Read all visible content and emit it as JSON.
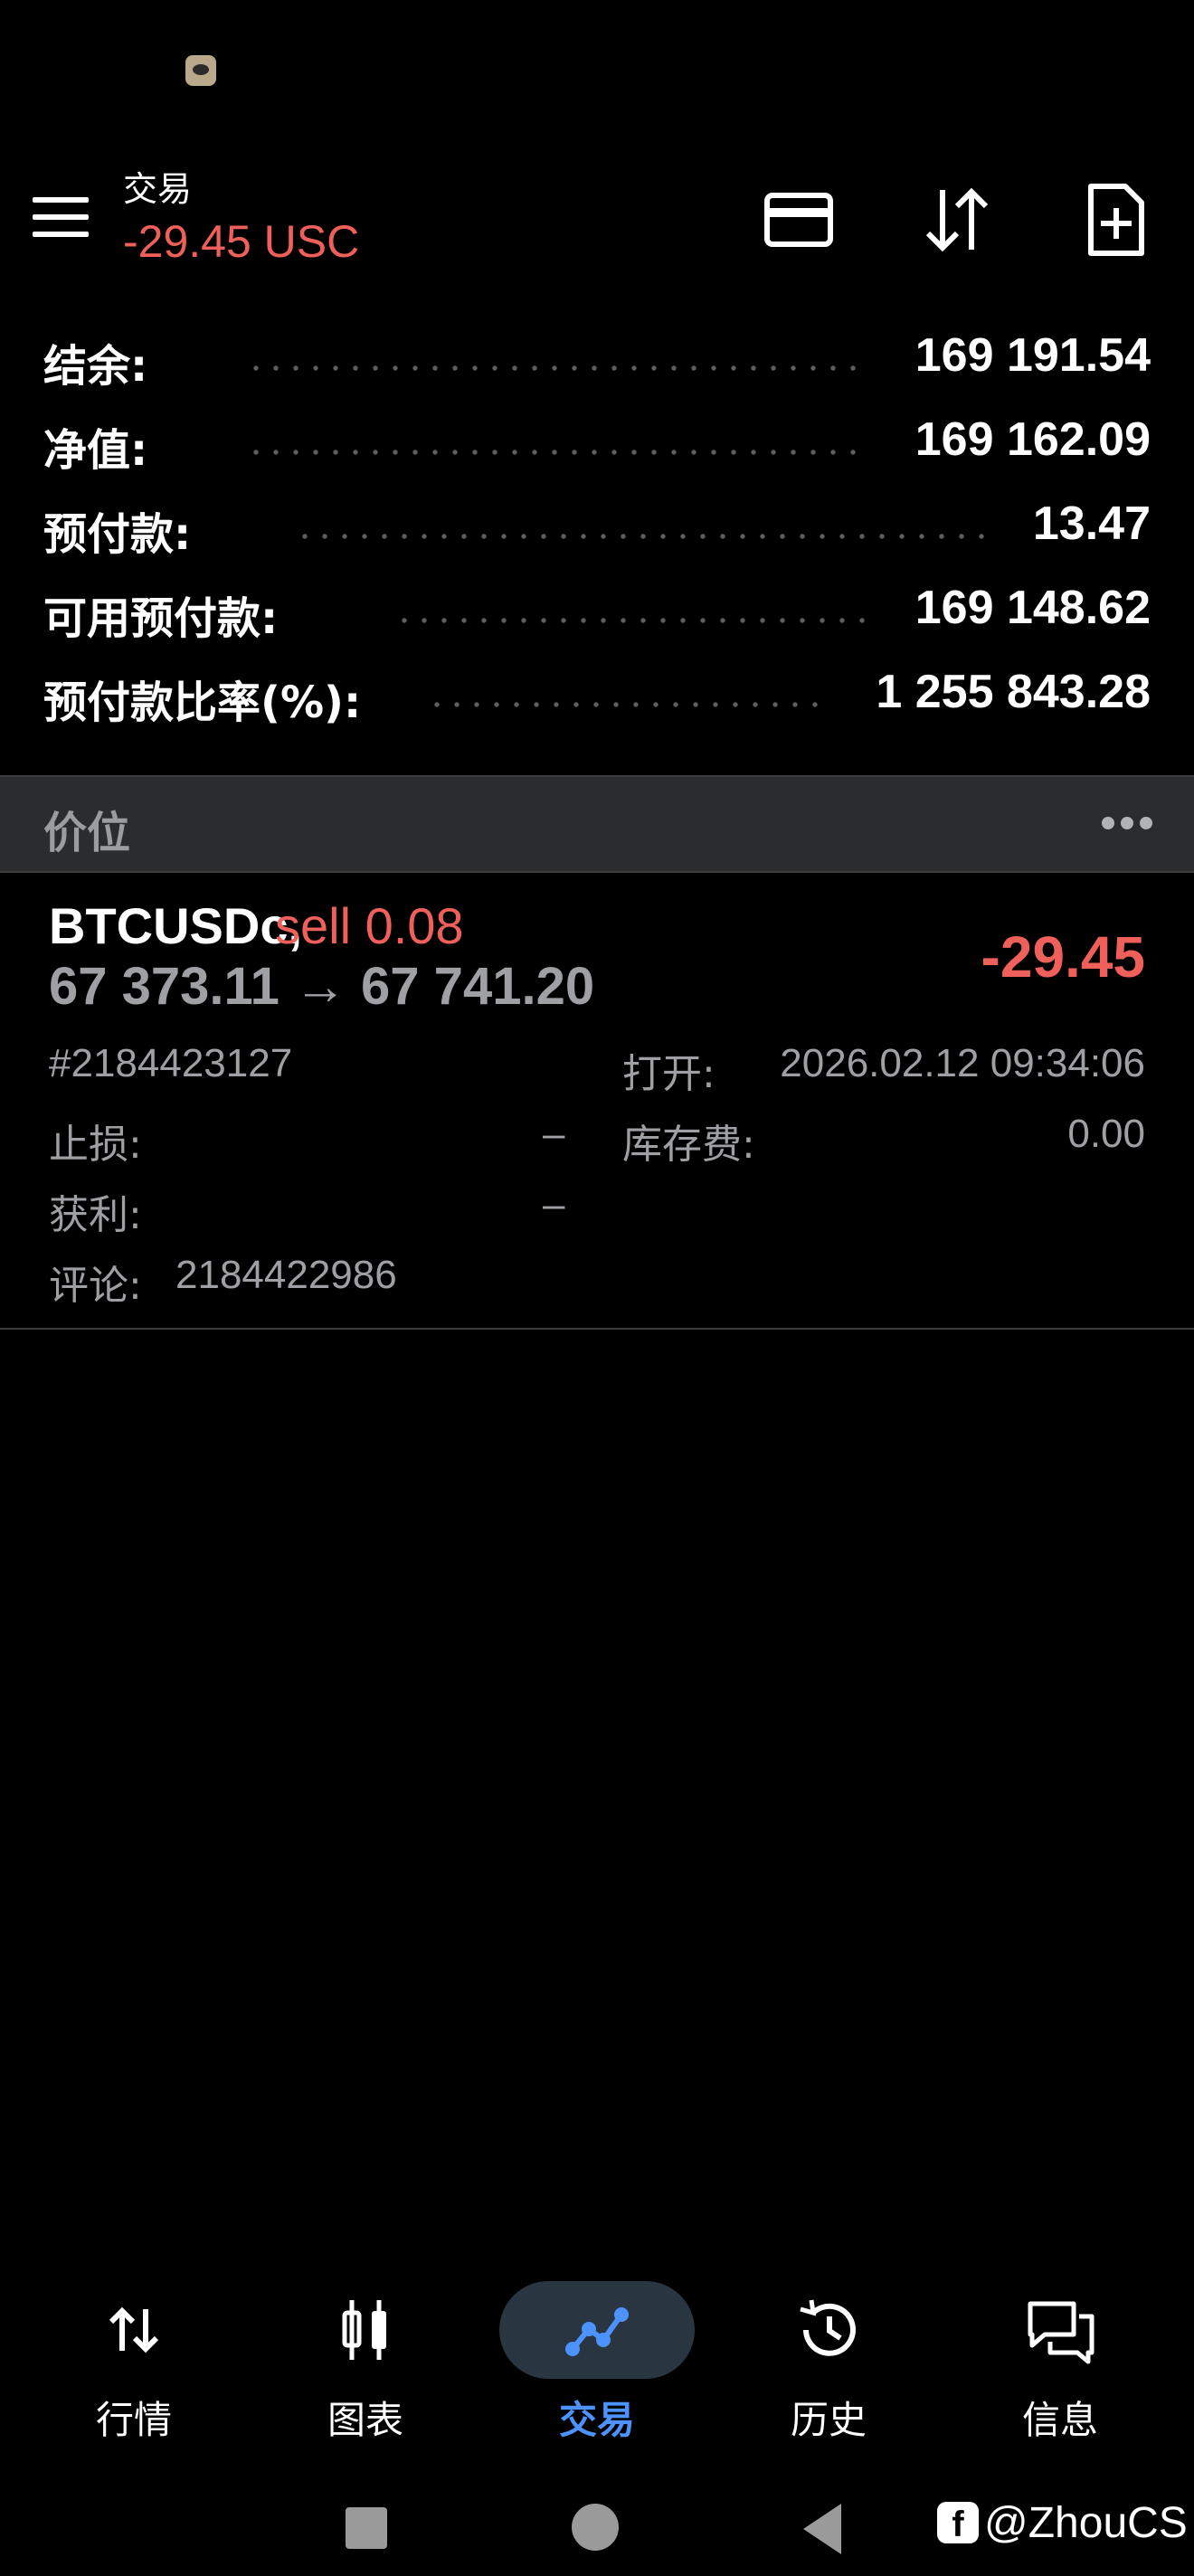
{
  "header": {
    "title": "交易",
    "subtitle": "-29.45 USC",
    "icons": [
      "credit-card-icon",
      "sort-arrows-icon",
      "new-document-icon"
    ]
  },
  "summary": [
    {
      "label": "结余:",
      "value": "169 191.54"
    },
    {
      "label": "净值:",
      "value": "169 162.09"
    },
    {
      "label": "预付款:",
      "value": "13.47"
    },
    {
      "label": "可用预付款:",
      "value": "169 148.62"
    },
    {
      "label": "预付款比率(%):",
      "value": "1 255 843.28"
    }
  ],
  "section": {
    "title": "价位"
  },
  "position": {
    "symbol": "BTCUSDc,",
    "side": "sell 0.08",
    "prices": "67 373.11 → 67 741.20",
    "profit": "-29.45",
    "ticket": "#2184423127",
    "open_label": "打开:",
    "open_time": "2026.02.12 09:34:06",
    "sl_label": "止损:",
    "sl_value": "–",
    "swap_label": "库存费:",
    "swap_value": "0.00",
    "tp_label": "获利:",
    "tp_value": "–",
    "comment_label": "评论:",
    "comment_value": "2184422986"
  },
  "bottom_nav": [
    {
      "label": "行情",
      "icon": "quotes-arrows-icon"
    },
    {
      "label": "图表",
      "icon": "candlestick-icon"
    },
    {
      "label": "交易",
      "icon": "trade-line-icon",
      "active": true
    },
    {
      "label": "历史",
      "icon": "history-clock-icon"
    },
    {
      "label": "信息",
      "icon": "messages-icon"
    }
  ],
  "watermark": {
    "logo": "f",
    "text": "@ZhouCS"
  },
  "colors": {
    "negative": "#f0605a",
    "accent": "#4d93ff",
    "background": "#000000"
  }
}
